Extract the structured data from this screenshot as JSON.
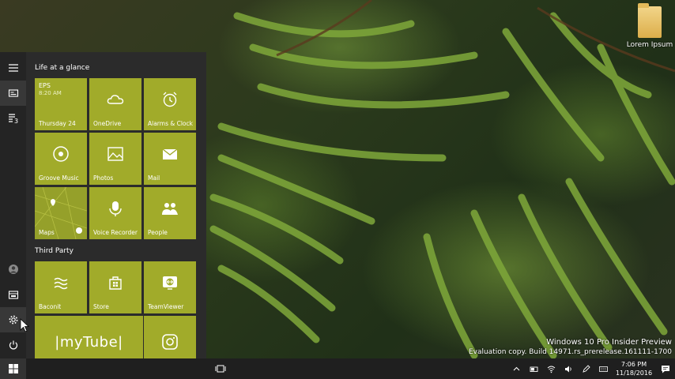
{
  "desktop": {
    "icon_label": "Lorem Ipsum",
    "watermark_line1": "Windows 10 Pro Insider Preview",
    "watermark_line2": "Evaluation copy. Build 14971.rs_prerelease.161111-1700"
  },
  "start_menu": {
    "groups": [
      {
        "title": "Life at a glance",
        "tiles": [
          {
            "label": "Thursday 24",
            "icon": "calendar-icon",
            "app": "EPS",
            "time": "8:20 AM"
          },
          {
            "label": "OneDrive",
            "icon": "cloud-icon"
          },
          {
            "label": "Alarms & Clock",
            "icon": "alarm-clock-icon"
          },
          {
            "label": "Groove Music",
            "icon": "music-disc-icon"
          },
          {
            "label": "Photos",
            "icon": "photos-icon"
          },
          {
            "label": "Mail",
            "icon": "mail-icon"
          },
          {
            "label": "Maps",
            "icon": "map-icon"
          },
          {
            "label": "Voice Recorder",
            "icon": "microphone-icon"
          },
          {
            "label": "People",
            "icon": "people-icon"
          }
        ]
      },
      {
        "title": "Third Party",
        "tiles": [
          {
            "label": "Baconit",
            "icon": "baconit-icon"
          },
          {
            "label": "Store",
            "icon": "store-icon"
          },
          {
            "label": "TeamViewer",
            "icon": "teamviewer-icon"
          },
          {
            "label": "|myTube|",
            "icon": "mytube-logo"
          },
          {
            "label": "",
            "icon": "instagram-icon"
          }
        ]
      }
    ],
    "rail_items": [
      "hamburger-icon",
      "tiles-icon",
      "all-apps-icon",
      "user-avatar",
      "explorer-icon",
      "gear-icon",
      "power-icon"
    ],
    "all_apps_badge": "3"
  },
  "taskbar": {
    "time": "7:06 PM",
    "date": "11/18/2016"
  },
  "colors": {
    "accent": "#a1ab2a",
    "menu_bg": "#2b2b2b",
    "taskbar_bg": "#1f1f1f"
  }
}
